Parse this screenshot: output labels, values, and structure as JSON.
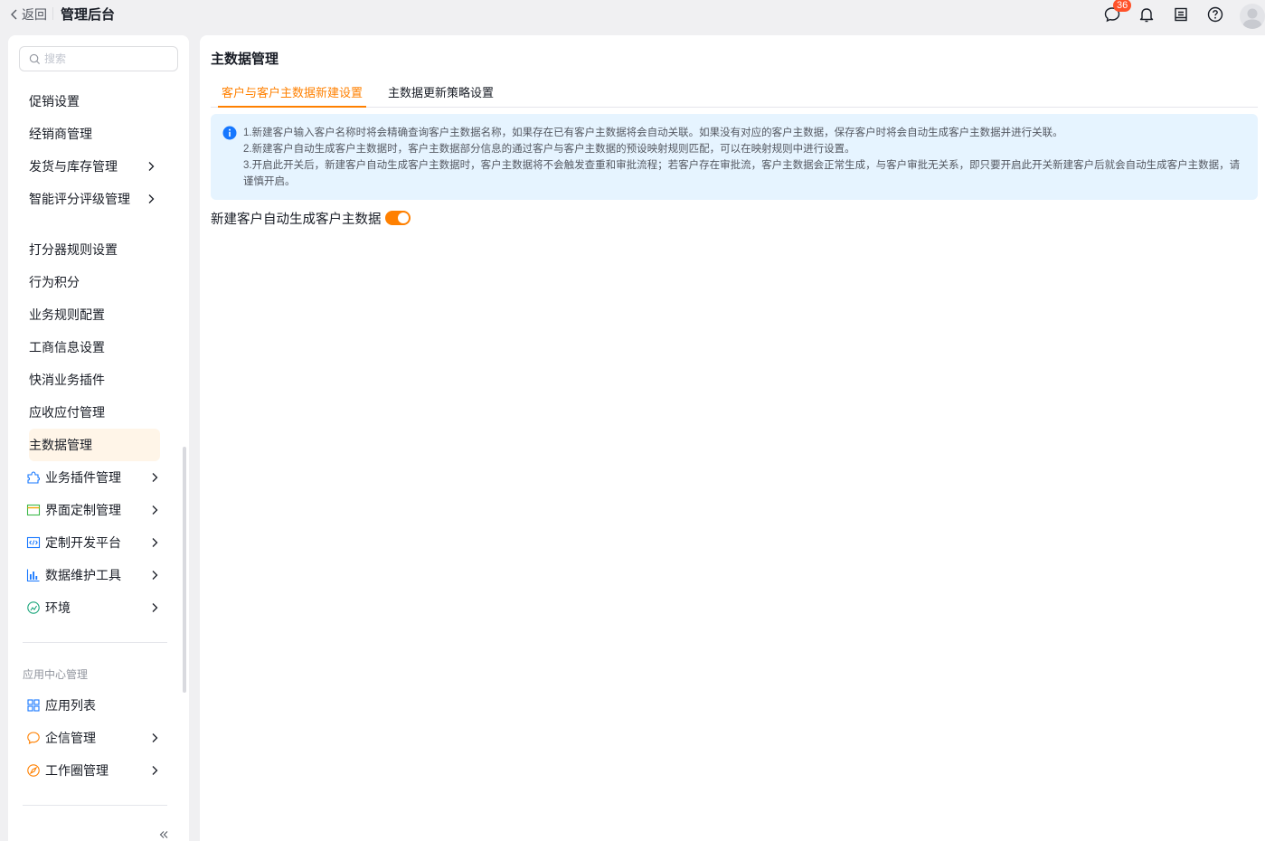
{
  "header": {
    "back_label": "返回",
    "app_title": "管理后台",
    "message_count": "36"
  },
  "sidebar": {
    "search_placeholder": "搜索",
    "sub_items": [
      {
        "label": "促销设置"
      },
      {
        "label": "经销商管理"
      },
      {
        "label": "发货与库存管理"
      },
      {
        "label": "智能评分评级管理"
      },
      {
        "label": "打分器规则设置"
      },
      {
        "label": "行为积分"
      },
      {
        "label": "业务规则配置"
      },
      {
        "label": "工商信息设置"
      },
      {
        "label": "快消业务插件"
      },
      {
        "label": "应收应付管理"
      },
      {
        "label": "主数据管理"
      }
    ],
    "main_items": [
      {
        "label": "业务插件管理",
        "icon": "puzzle-icon"
      },
      {
        "label": "界面定制管理",
        "icon": "window-icon"
      },
      {
        "label": "定制开发平台",
        "icon": "code-icon"
      },
      {
        "label": "数据维护工具",
        "icon": "bar-chart-icon"
      },
      {
        "label": "环境",
        "icon": "environment-icon"
      }
    ],
    "group_label": "应用中心管理",
    "app_items": [
      {
        "label": "应用列表",
        "icon": "grid-icon"
      },
      {
        "label": "企信管理",
        "icon": "chat-icon"
      },
      {
        "label": "工作圈管理",
        "icon": "compass-icon"
      }
    ]
  },
  "main": {
    "title": "主数据管理",
    "tabs": [
      {
        "label": "客户与客户主数据新建设置",
        "active": true
      },
      {
        "label": "主数据更新策略设置",
        "active": false
      }
    ],
    "notice": [
      "1.新建客户输入客户名称时将会精确查询客户主数据名称，如果存在已有客户主数据将会自动关联。如果没有对应的客户主数据，保存客户时将会自动生成客户主数据并进行关联。",
      "2.新建客户自动生成客户主数据时，客户主数据部分信息的通过客户与客户主数据的预设映射规则匹配，可以在映射规则中进行设置。",
      "3.开启此开关后，新建客户自动生成客户主数据时，客户主数据将不会触发查重和审批流程；若客户存在审批流，客户主数据会正常生成，与客户审批无关系，即只要开启此开关新建客户后就会自动生成客户主数据，请谨慎开启。"
    ],
    "setting_label": "新建客户自动生成客户主数据",
    "setting_enabled": true
  },
  "colors": {
    "accent": "#ff8000",
    "active_bg": "#fff5e8",
    "notice_bg": "#e6f4ff",
    "info_blue": "#1677ff",
    "badge": "#ff522a"
  }
}
